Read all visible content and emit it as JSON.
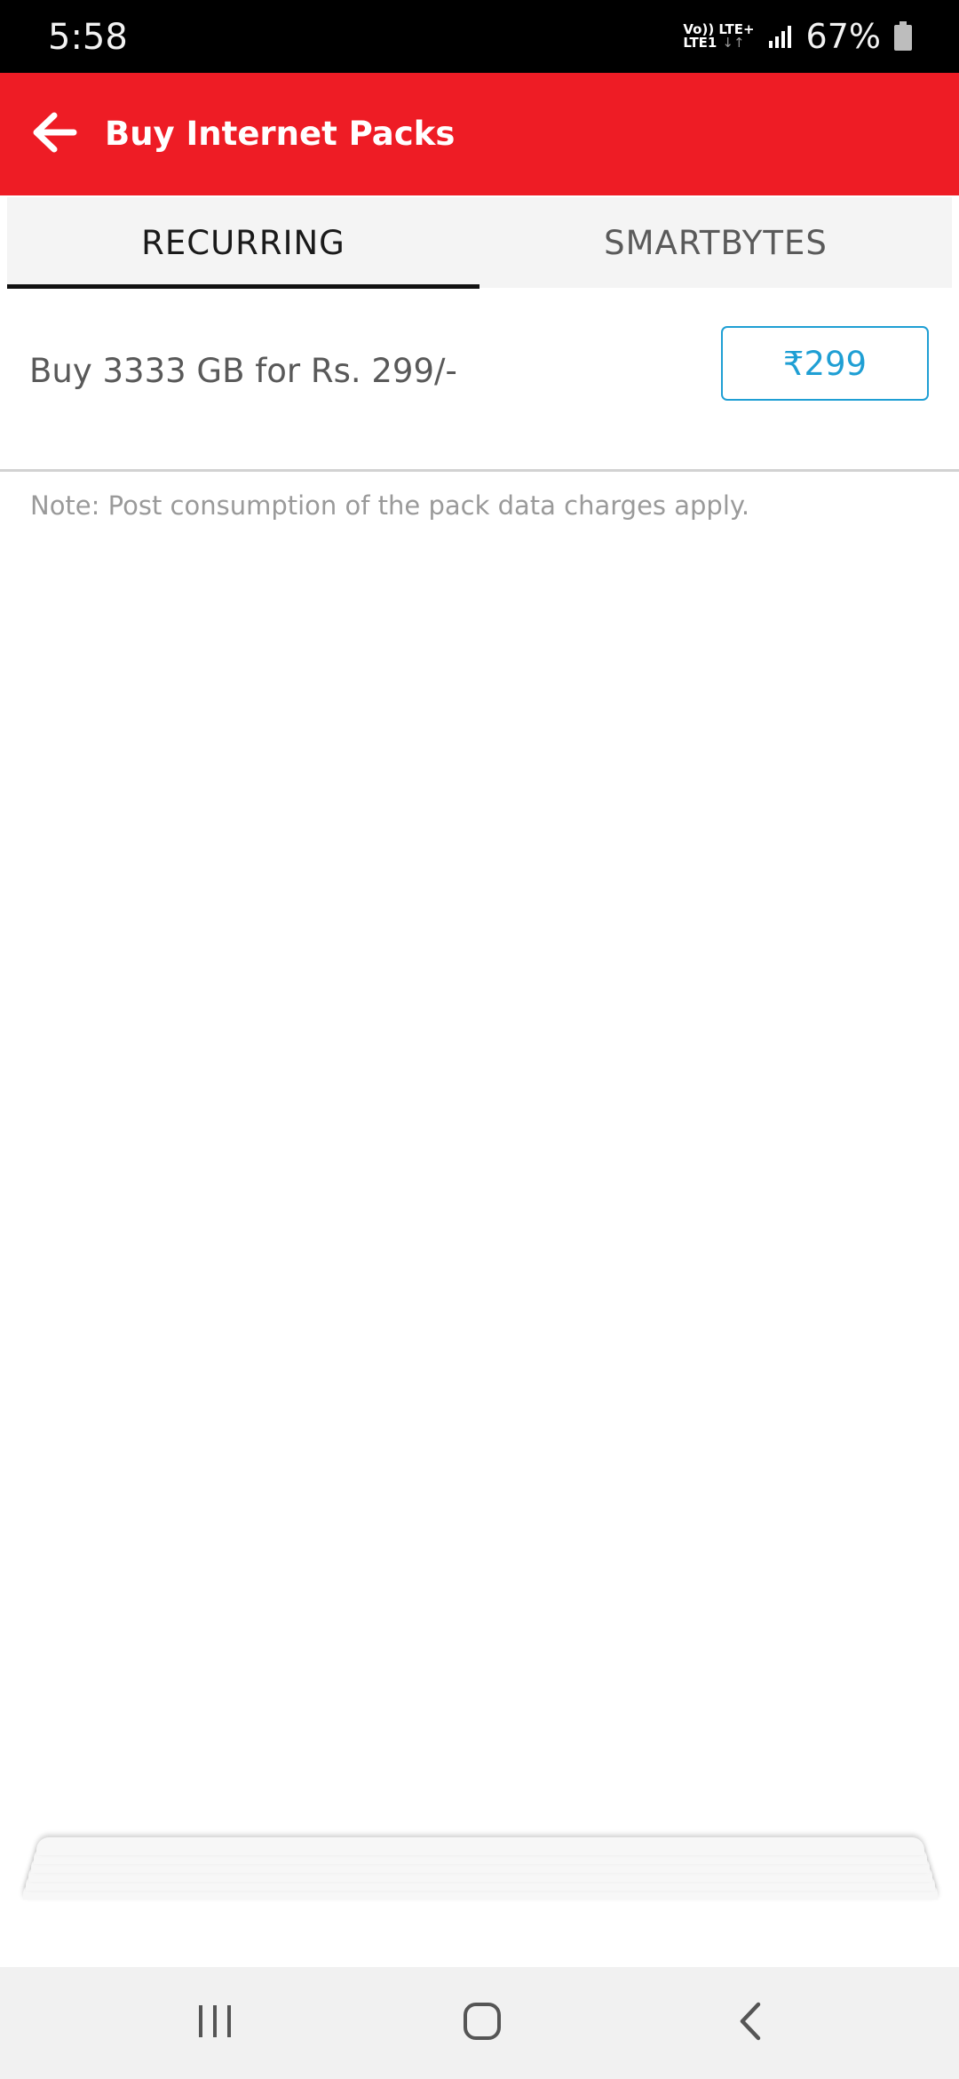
{
  "status_bar": {
    "time": "5:58",
    "net_top": "Vo)) LTE+",
    "net_bottom": "LTE1",
    "battery_percent": "67%",
    "battery_level": 0.67
  },
  "app_bar": {
    "title": "Buy Internet Packs",
    "background_color": "#ee1c25",
    "back_icon": "arrow-left-icon"
  },
  "tabs": [
    {
      "label": "RECURRING",
      "active": true
    },
    {
      "label": "SMARTBYTES",
      "active": false
    }
  ],
  "pack": {
    "description": "Buy 3333 GB for Rs. 299/-",
    "price_label": "₹299",
    "accent_color": "#1f9fd4"
  },
  "note": "Note: Post consumption of the pack data charges apply.",
  "nav_bar": {
    "recents_icon": "recents-icon",
    "home_icon": "home-icon",
    "back_icon": "back-chevron-icon"
  }
}
